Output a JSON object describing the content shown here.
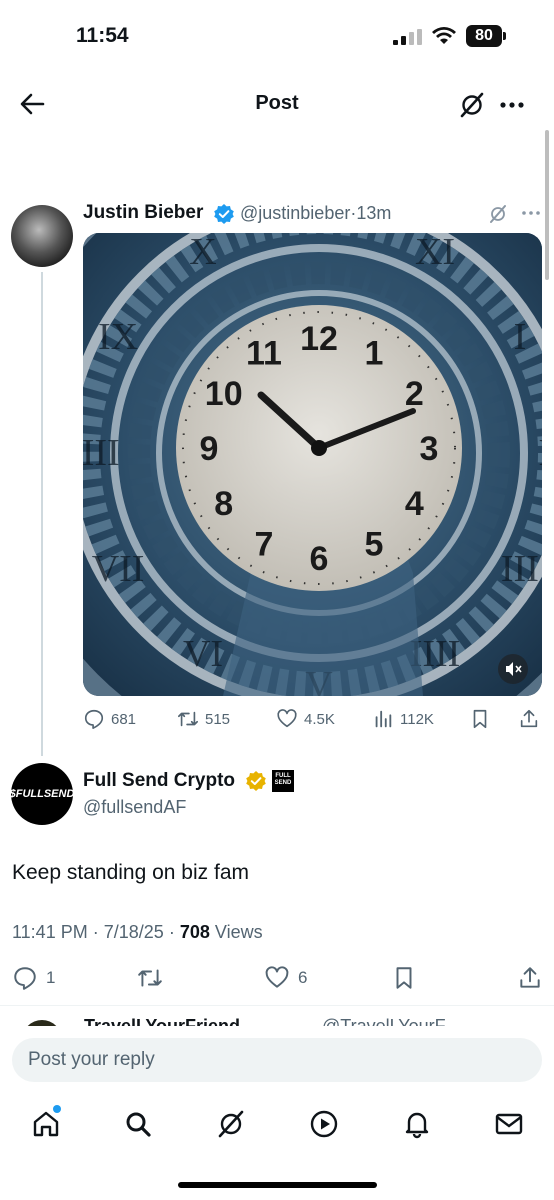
{
  "status_bar": {
    "time": "11:54",
    "battery": "80"
  },
  "header": {
    "title": "Post"
  },
  "quoted_tweet": {
    "name": "Justin Bieber",
    "handle": "@justinbieber",
    "sep": "·",
    "age": "13m",
    "stats": {
      "replies": "681",
      "reposts": "515",
      "likes": "4.5K",
      "views": "112K"
    },
    "media": {
      "description_icon": "clock-video",
      "numerals": [
        "12",
        "1",
        "2",
        "3",
        "4",
        "5",
        "6",
        "7",
        "8",
        "9",
        "10",
        "11"
      ],
      "roman": [
        "XII",
        "XI",
        "I",
        "II",
        "III",
        "IIII",
        "V",
        "VI",
        "VII",
        "VIII",
        "IX",
        "X"
      ]
    }
  },
  "main_tweet": {
    "avatar_text": "$FULLSEND",
    "badge_text": "FULL SEND",
    "name": "Full Send Crypto",
    "handle": "@fullsendAF",
    "text": "Keep standing on biz fam",
    "time": "11:41 PM",
    "date": "7/18/25",
    "views_count": "708",
    "views_label": "Views",
    "sep": "·",
    "stats": {
      "replies": "1",
      "likes": "6"
    }
  },
  "next_reply": {
    "name": "TravelLYourFriend",
    "handle": "@TravelLYourF..."
  },
  "reply_box": {
    "placeholder": "Post your reply"
  },
  "colors": {
    "accent": "#1d9bf0",
    "verified": "#1d9bf0",
    "gold": "#e8b300",
    "muted": "#536471"
  }
}
